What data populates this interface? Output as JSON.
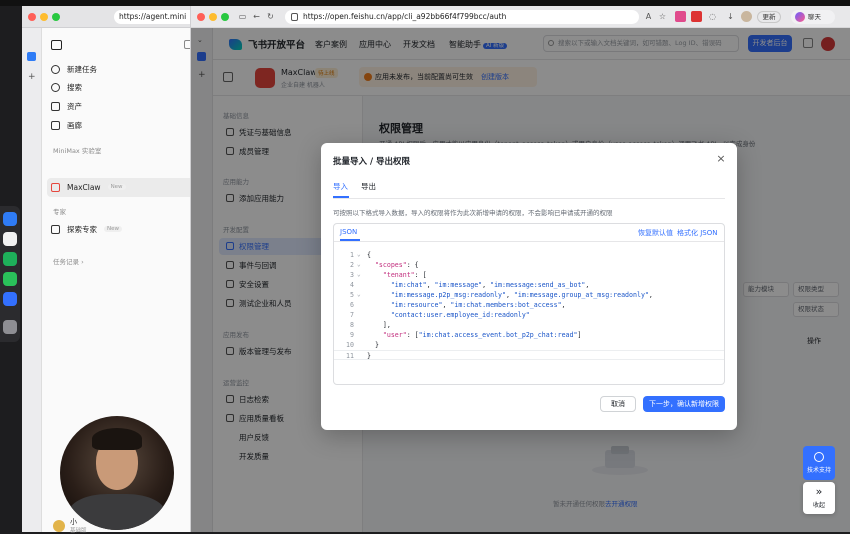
{
  "back_window": {
    "url": "https://agent.mini",
    "nav": {
      "new_task": "新建任务",
      "search": "搜索",
      "assets": "资产",
      "gallery": "画廊",
      "section_lab": "MiniMax 实验室",
      "maxclaw": "MaxClaw",
      "maxclaw_badge": "New",
      "section_experts": "专家",
      "explore_experts": "探索专家",
      "explore_badge": "New",
      "task_history": "任务记录 ›"
    },
    "presenter_name": "小",
    "presenter_sub": "基础版"
  },
  "browser": {
    "url": "https://open.feishu.cn/app/cli_a92bb66f4f799bcc/auth",
    "update_label": "更新",
    "chat_label": "聊天"
  },
  "topnav": {
    "brand": "飞书开放平台",
    "links": [
      "客户案例",
      "应用中心",
      "开发文档",
      "智能助手"
    ],
    "ai_badge": "AI 新版",
    "search_placeholder": "搜索以下或输入文档关键词，如可错题、Log ID、错误码",
    "console_button": "开发者后台"
  },
  "app_header": {
    "name": "MaxClaw",
    "tag": "待上线",
    "subtitle": "企业自建 机器人",
    "release_notice": "应用未发布，当前配置尚可生效",
    "release_link": "创建版本"
  },
  "sidenav": {
    "sections": [
      {
        "title": "基础信息",
        "items": [
          "凭证与基础信息",
          "成员管理"
        ]
      },
      {
        "title": "应用能力",
        "items": [
          "添加应用能力"
        ]
      },
      {
        "title": "开发配置",
        "items": [
          "权限管理",
          "事件与回调",
          "安全设置",
          "测试企业和人员"
        ]
      },
      {
        "title": "应用发布",
        "items": [
          "版本管理与发布"
        ]
      },
      {
        "title": "运营监控",
        "items": [
          "日志检索",
          "应用质量看板"
        ]
      }
    ],
    "sub_items": [
      "用户反馈",
      "开发质量"
    ]
  },
  "content": {
    "title": "权限管理",
    "description": "开通 API 权限后，应用才能以应用身份（tenant_access_token）或用户身份（user_access_token）调用飞书 API，以完成身份",
    "filters": [
      "能力模块",
      "权限类型",
      "权限状态"
    ],
    "col_ops": "操作",
    "empty_text": "暂未开通任何权限",
    "empty_link": "去开通权限"
  },
  "modal": {
    "title": "批量导入 / 导出权限",
    "tabs": [
      "导入",
      "导出"
    ],
    "hint": "可按照以下格式导入数据，导入的权限将作为此次新增申请的权限，不会影响已申请或开通的权限",
    "editor_tab": "JSON",
    "restore_default": "恢复默认值",
    "format_json": "格式化 JSON",
    "cancel": "取消",
    "next": "下一步，确认新增权限",
    "code_lines": [
      "{",
      "  \"scopes\": {",
      "    \"tenant\": [",
      "      \"im:chat\", \"im:message\", \"im:message:send_as_bot\",",
      "      \"im:message.p2p_msg:readonly\", \"im:message.group_at_msg:readonly\",",
      "      \"im:resource\", \"im:chat.members:bot_access\",",
      "      \"contact:user.employee_id:readonly\"",
      "    ],",
      "    \"user\": [\"im:chat.access_event.bot_p2p_chat:read\"]",
      "  }",
      "}"
    ]
  },
  "floating": {
    "support": "技术支持",
    "collapse": "收起"
  },
  "colors": {
    "primary": "#3370ff",
    "overlay": "rgba(0,0,0,0.45)",
    "active_nav_bg": "#e1eaff"
  }
}
